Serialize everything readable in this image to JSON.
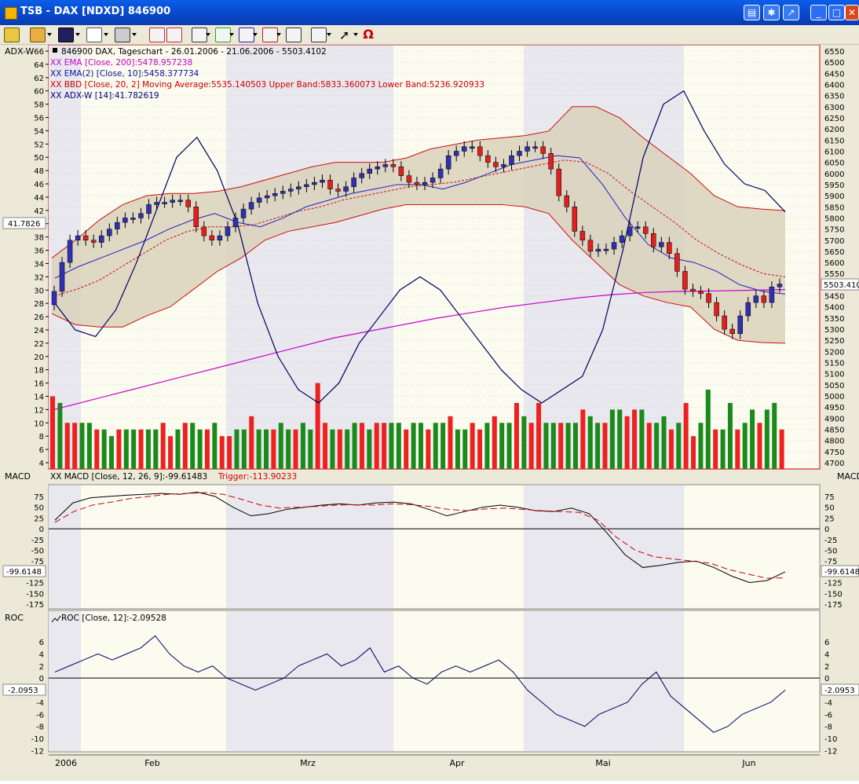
{
  "window": {
    "title": "TSB - DAX [NDXD] 846900"
  },
  "main_panel": {
    "tag": "ADX-W",
    "legend": [
      {
        "text": "846900  DAX, Tageschart - 26.01.2006 - 21.06.2006 - 5503.4102",
        "color": "#000000"
      },
      {
        "text": "XX EMA [Close, 200]:5478.957238",
        "color": "#cc00cc"
      },
      {
        "text": "XX EMA(2) [Close, 10]:5458.377734",
        "color": "#1010a0"
      },
      {
        "text": "XX BBD [Close, 20, 2] Moving Average:5535.140503 Upper Band:5833.360073 Lower Band:5236.920933",
        "color": "#cc0000"
      },
      {
        "text": "XX ADX-W [14]:41.782619",
        "color": "#000080"
      }
    ],
    "left_axis_ticks": [
      "66",
      "64",
      "62",
      "60",
      "58",
      "56",
      "54",
      "52",
      "50",
      "48",
      "46",
      "44",
      "42",
      "40",
      "38",
      "36",
      "34",
      "32",
      "30",
      "28",
      "26",
      "24",
      "22",
      "20",
      "18",
      "16",
      "14",
      "12",
      "10",
      "8",
      "6",
      "4"
    ],
    "right_axis_ticks": [
      "6550",
      "6500",
      "6450",
      "6400",
      "6350",
      "6300",
      "6250",
      "6200",
      "6150",
      "6100",
      "6050",
      "6000",
      "5950",
      "5900",
      "5850",
      "5800",
      "5750",
      "5700",
      "5650",
      "5600",
      "5550",
      "5500",
      "5450",
      "5400",
      "5350",
      "5300",
      "5250",
      "5200",
      "5150",
      "5100",
      "5050",
      "5000",
      "4950",
      "4900",
      "4850",
      "4800",
      "4750",
      "4700"
    ],
    "left_value_label": "41.7826",
    "right_value_label": "5503.410"
  },
  "macd_panel": {
    "tag_left": "MACD",
    "tag_right": "MACD",
    "legend_a": "XX MACD [Close, 12, 26, 9]:-99.61483",
    "legend_b": "Trigger:-113.90233",
    "ticks": [
      "75",
      "50",
      "25",
      "0",
      "-25",
      "-50",
      "-75",
      "-100",
      "-125",
      "-150",
      "-175"
    ],
    "value_label": "-99.6148"
  },
  "roc_panel": {
    "tag": "ROC",
    "legend": "ROC [Close, 12]:-2.09528",
    "ticks": [
      "6",
      "4",
      "2",
      "0",
      "-2",
      "-4",
      "-6",
      "-8",
      "-10",
      "-12"
    ],
    "value_label": "-2.0953"
  },
  "x_axis": {
    "labels": [
      "2006",
      "Feb",
      "Mrz",
      "Apr",
      "Mai",
      "Jun"
    ]
  },
  "colors": {
    "up": "#3030b0",
    "down": "#e02020",
    "vol_up": "#1a8a1a",
    "vol_down": "#ee2020",
    "band_fill": "#d8d0b8",
    "ema200": "#cc00cc",
    "ema10": "#2020c0",
    "bband": "#cc1010",
    "adx": "#000060"
  },
  "chart_data": [
    {
      "type": "line",
      "title": "846900 DAX, Tageschart - 26.01.2006 - 21.06.2006 - 5503.4102",
      "xlabel": "",
      "ylabel": "",
      "x": [
        "2006",
        "Feb",
        "Mrz",
        "Apr",
        "Mai",
        "Jun"
      ],
      "ylim": [
        4700,
        6550
      ],
      "series": [
        {
          "name": "846900 DAX (Close)",
          "values": [
            5470,
            5600,
            5700,
            5720,
            5700,
            5690,
            5720,
            5750,
            5780,
            5800,
            5800,
            5820,
            5860,
            5870,
            5870,
            5880,
            5880,
            5850,
            5760,
            5720,
            5700,
            5720,
            5760,
            5800,
            5840,
            5870,
            5890,
            5900,
            5910,
            5920,
            5930,
            5940,
            5950,
            5960,
            5970,
            5930,
            5920,
            5940,
            5980,
            6000,
            6020,
            6030,
            6040,
            6030,
            5990,
            5960,
            5950,
            5960,
            5980,
            6020,
            6080,
            6100,
            6120,
            6120,
            6080,
            6050,
            6030,
            6040,
            6080,
            6100,
            6120,
            6120,
            6090,
            6020,
            5900,
            5850,
            5740,
            5700,
            5650,
            5660,
            5660,
            5690,
            5720,
            5760,
            5760,
            5730,
            5670,
            5690,
            5640,
            5560,
            5480,
            5470,
            5460,
            5420,
            5360,
            5300,
            5280,
            5360,
            5420,
            5450,
            5420,
            5490,
            5503
          ]
        },
        {
          "name": "XX EMA [Close, 200]",
          "values": [
            4940,
            4980,
            5020,
            5060,
            5100,
            5140,
            5180,
            5220,
            5260,
            5290,
            5320,
            5350,
            5375,
            5400,
            5420,
            5440,
            5455,
            5465,
            5470,
            5472,
            5475,
            5478
          ]
        },
        {
          "name": "XX EMA(2) [Close, 10]",
          "values": [
            5530,
            5580,
            5620,
            5660,
            5700,
            5750,
            5790,
            5820,
            5780,
            5760,
            5800,
            5850,
            5880,
            5910,
            5930,
            5950,
            5950,
            5930,
            5960,
            6000,
            6040,
            6060,
            6080,
            6070,
            5950,
            5800,
            5680,
            5620,
            5600,
            5560,
            5500,
            5470,
            5458
          ]
        },
        {
          "name": "XX BBD Moving Average",
          "values": [
            5450,
            5480,
            5520,
            5580,
            5640,
            5700,
            5740,
            5760,
            5760,
            5770,
            5800,
            5830,
            5850,
            5880,
            5900,
            5920,
            5940,
            5950,
            5960,
            5980,
            6000,
            6020,
            6040,
            6060,
            6050,
            6000,
            5920,
            5850,
            5780,
            5700,
            5640,
            5590,
            5550,
            5535
          ]
        },
        {
          "name": "XX BBD Upper Band",
          "values": [
            5620,
            5700,
            5790,
            5860,
            5900,
            5910,
            5910,
            5920,
            5940,
            5970,
            6000,
            6030,
            6050,
            6050,
            6050,
            6070,
            6110,
            6130,
            6150,
            6160,
            6170,
            6190,
            6300,
            6300,
            6250,
            6160,
            6080,
            6000,
            5900,
            5850,
            5840,
            5833
          ]
        },
        {
          "name": "XX BBD Lower Band",
          "values": [
            5370,
            5320,
            5310,
            5310,
            5360,
            5400,
            5480,
            5560,
            5620,
            5700,
            5740,
            5760,
            5780,
            5810,
            5840,
            5860,
            5860,
            5860,
            5860,
            5860,
            5850,
            5820,
            5700,
            5600,
            5500,
            5450,
            5420,
            5400,
            5300,
            5250,
            5240,
            5237
          ]
        },
        {
          "name": "XX ADX-W [14]",
          "values": [
            28,
            24,
            23,
            27,
            34,
            42,
            50,
            53,
            48,
            40,
            28,
            20,
            15,
            13,
            16,
            22,
            26,
            30,
            32,
            30,
            26,
            22,
            18,
            15,
            13,
            15,
            17,
            24,
            36,
            50,
            58,
            60,
            54,
            49,
            46,
            45,
            41.78
          ]
        }
      ]
    },
    {
      "type": "bar",
      "title": "",
      "x": [
        "2006",
        "Feb",
        "Mrz",
        "Apr",
        "Mai",
        "Jun"
      ],
      "series": [
        {
          "name": "",
          "values": [
            14,
            13,
            10,
            10,
            10,
            10,
            9,
            9,
            8,
            9,
            9,
            9,
            9,
            9,
            9,
            10,
            8,
            9,
            10,
            10,
            9,
            9,
            10,
            8,
            8,
            9,
            9,
            11,
            9,
            9,
            9,
            10,
            9,
            9,
            10,
            9,
            16,
            10,
            9,
            9,
            9,
            10,
            10,
            9,
            10,
            10,
            10,
            10,
            9,
            10,
            10,
            9,
            10,
            10,
            11,
            9,
            9,
            10,
            9,
            10,
            11,
            10,
            10,
            13,
            11,
            10,
            13,
            10,
            10,
            10,
            10,
            10,
            12,
            11,
            10,
            10,
            12,
            12,
            11,
            12,
            12,
            10,
            10,
            11,
            9,
            10,
            13,
            8,
            10,
            15,
            9,
            9,
            13,
            9,
            10,
            12,
            10,
            12,
            13,
            9
          ]
        }
      ]
    },
    {
      "type": "line",
      "title": "",
      "x": [
        "2006",
        "Feb",
        "Mrz",
        "Apr",
        "Mai",
        "Jun"
      ],
      "ylim": [
        -175,
        90
      ],
      "series": [
        {
          "name": "XX MACD [Close, 12, 26, 9]",
          "values": [
            20,
            60,
            72,
            75,
            78,
            80,
            82,
            80,
            85,
            75,
            50,
            30,
            35,
            45,
            50,
            55,
            58,
            55,
            60,
            62,
            58,
            45,
            30,
            40,
            50,
            55,
            50,
            42,
            40,
            48,
            35,
            -10,
            -60,
            -90,
            -85,
            -78,
            -75,
            -90,
            -110,
            -125,
            -120,
            -100
          ]
        },
        {
          "name": "Trigger",
          "values": [
            15,
            40,
            55,
            62,
            70,
            75,
            80,
            82,
            84,
            80,
            68,
            55,
            48,
            50,
            52,
            55,
            56,
            55,
            58,
            56,
            52,
            45,
            42,
            46,
            48,
            45,
            42,
            40,
            38,
            20,
            -20,
            -50,
            -65,
            -70,
            -75,
            -80,
            -95,
            -105,
            -115,
            -114
          ]
        }
      ]
    },
    {
      "type": "line",
      "title": "",
      "x": [
        "2006",
        "Feb",
        "Mrz",
        "Apr",
        "Mai",
        "Jun"
      ],
      "ylim": [
        -12,
        8
      ],
      "series": [
        {
          "name": "ROC [Close, 12]",
          "values": [
            1,
            2,
            3,
            4,
            3,
            4,
            5,
            7,
            4,
            2,
            1,
            2,
            0,
            -1,
            -2,
            -1,
            0,
            2,
            3,
            4,
            2,
            3,
            5,
            1,
            2,
            0,
            -1,
            1,
            2,
            1,
            2,
            3,
            1,
            -2,
            -4,
            -6,
            -7,
            -8,
            -6,
            -5,
            -4,
            -1,
            1,
            -3,
            -5,
            -7,
            -9,
            -8,
            -6,
            -5,
            -4,
            -2
          ]
        }
      ]
    }
  ]
}
